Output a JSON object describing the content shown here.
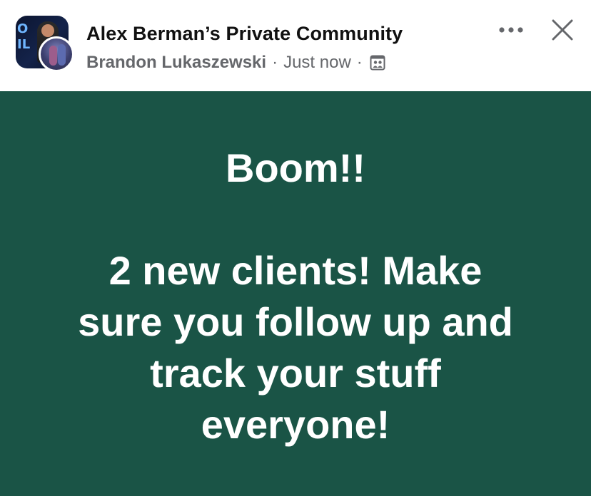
{
  "post": {
    "group_name": "Alex Berman’s Private Community",
    "author": "Brandon Lukaszewski",
    "separator": "·",
    "timestamp": "Just now",
    "privacy_icon": "group-members-icon",
    "more_icon": "more-options-icon",
    "close_icon": "close-icon",
    "background_color": "#1a5446",
    "text_lines": [
      "Boom!!",
      "",
      "2 new clients! Make",
      "sure you follow up and",
      "track your stuff",
      "everyone!"
    ]
  }
}
